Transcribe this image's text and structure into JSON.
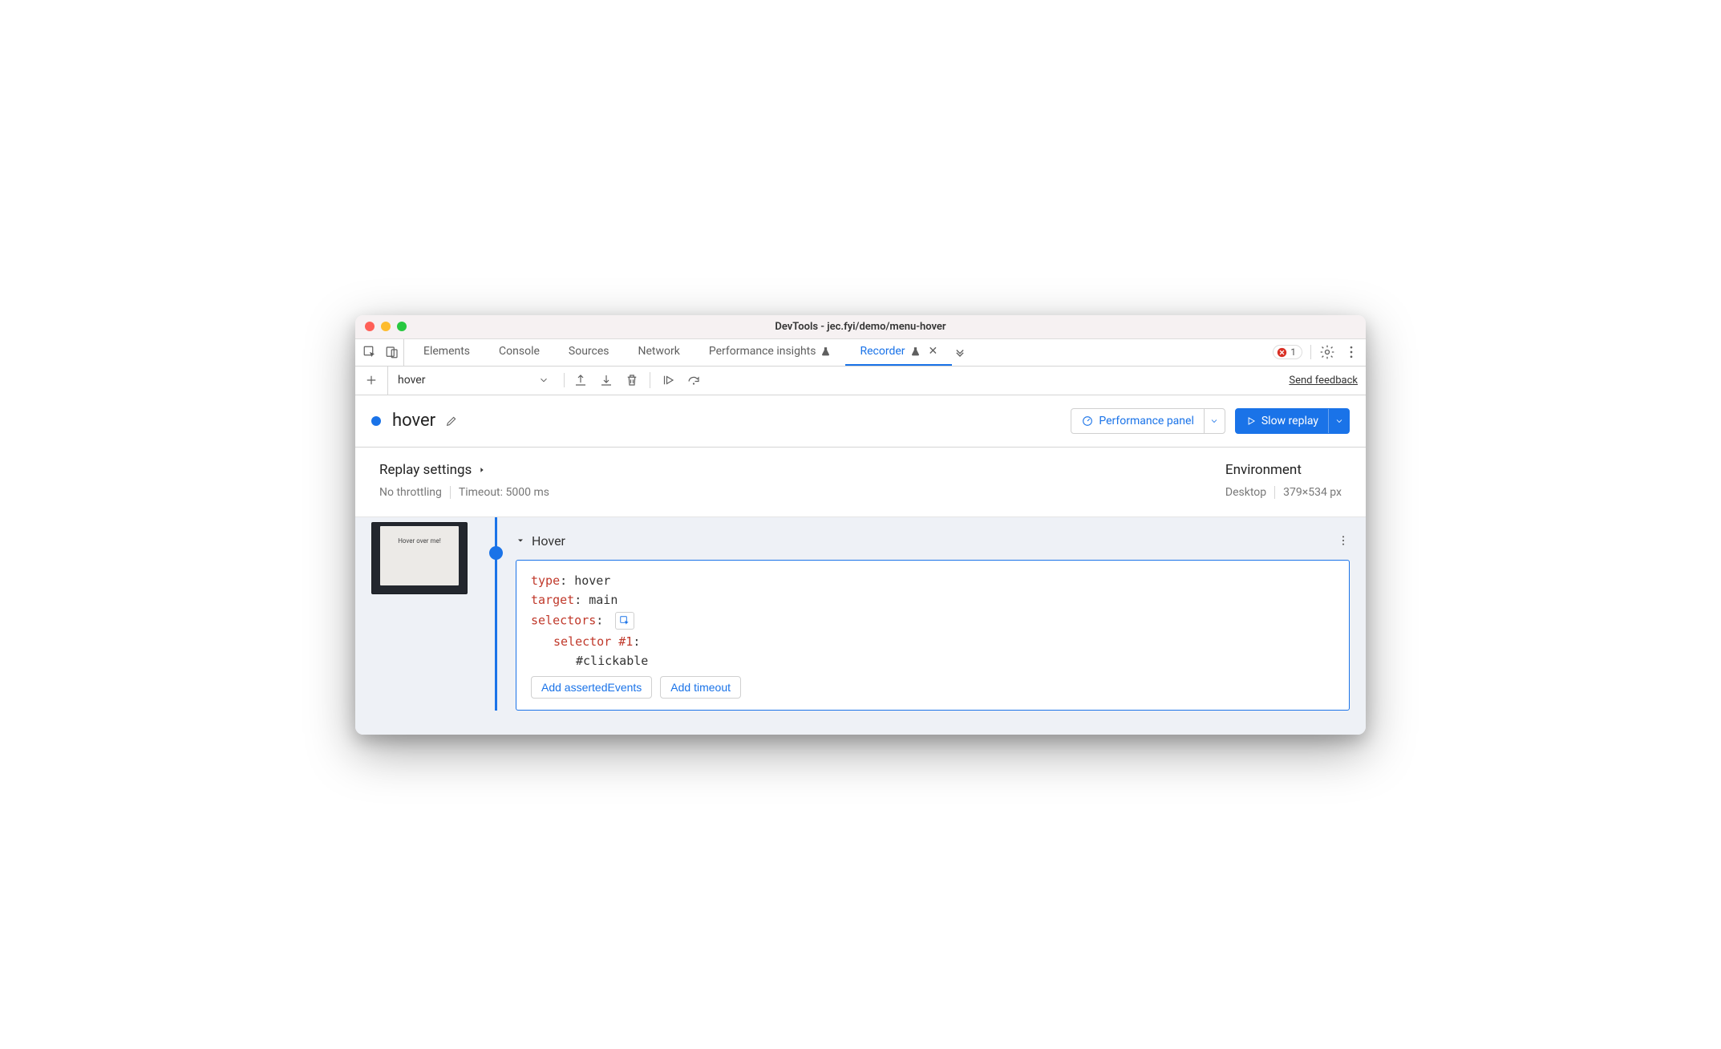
{
  "window": {
    "title": "DevTools - jec.fyi/demo/menu-hover"
  },
  "tabs": {
    "items": [
      "Elements",
      "Console",
      "Sources",
      "Network",
      "Performance insights",
      "Recorder"
    ],
    "active": "Recorder",
    "error_count": "1"
  },
  "toolbar": {
    "recording_name": "hover",
    "feedback_label": "Send feedback"
  },
  "title": {
    "name": "hover",
    "perf_label": "Performance panel",
    "replay_label": "Slow replay"
  },
  "settings": {
    "heading": "Replay settings",
    "throttling": "No throttling",
    "timeout": "Timeout: 5000 ms",
    "env_heading": "Environment",
    "device": "Desktop",
    "dimensions": "379×534 px"
  },
  "thumbnail": {
    "text": "Hover over me!"
  },
  "step": {
    "title": "Hover",
    "rows": {
      "type_key": "type",
      "type_val": "hover",
      "target_key": "target",
      "target_val": "main",
      "selectors_key": "selectors",
      "selector1_key": "selector #1",
      "selector1_val": "#clickable"
    },
    "buttons": {
      "asserted": "Add assertedEvents",
      "timeout": "Add timeout"
    }
  }
}
